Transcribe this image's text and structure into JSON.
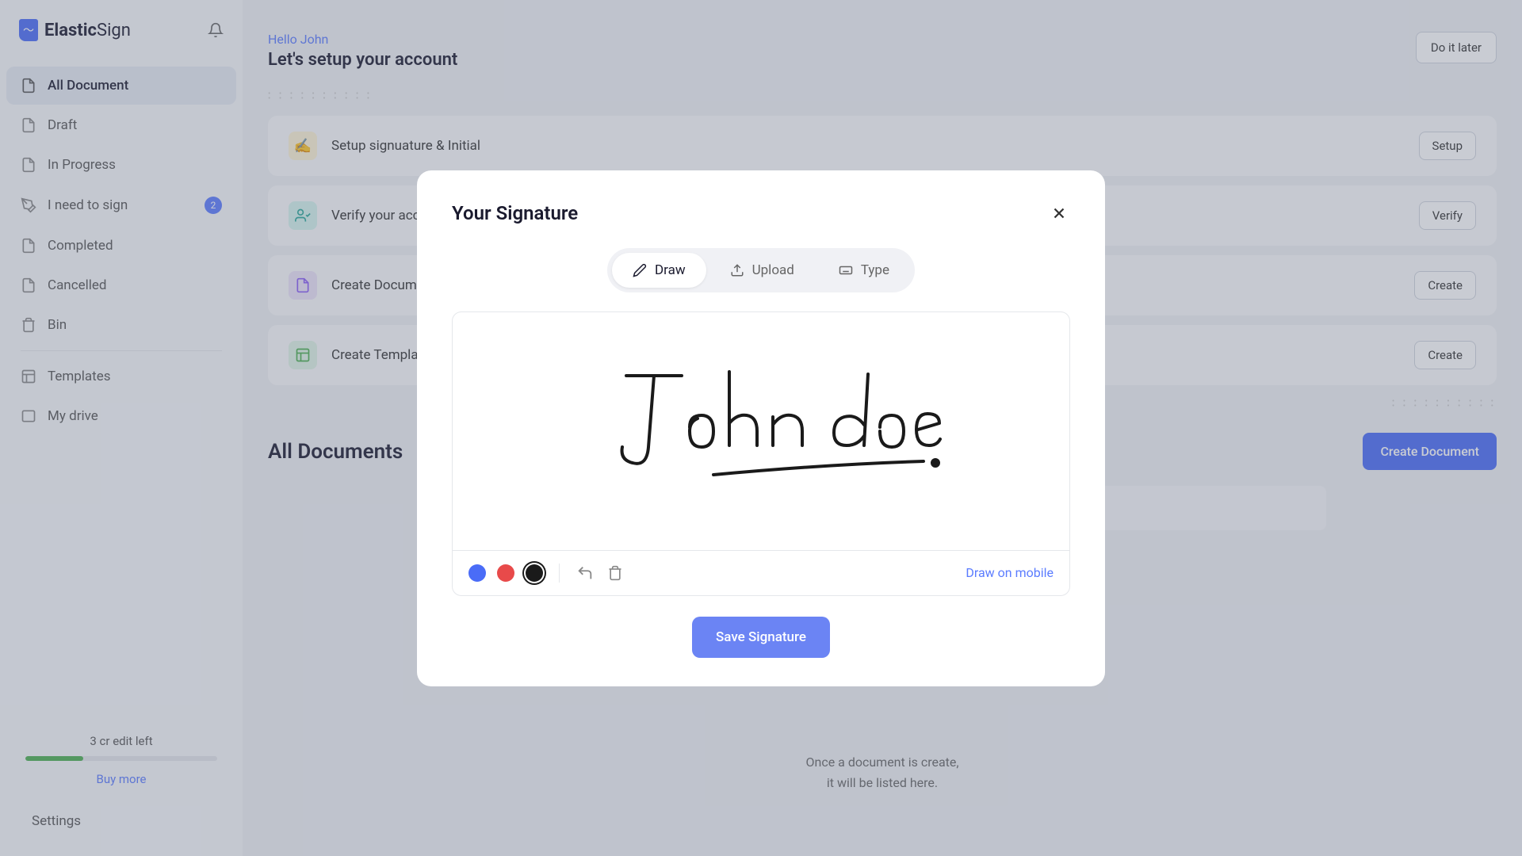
{
  "brand": {
    "bold": "Elastic",
    "light": "Sign"
  },
  "sidebar": {
    "items": [
      {
        "label": "All Document",
        "active": true
      },
      {
        "label": "Draft"
      },
      {
        "label": "In Progress"
      },
      {
        "label": "I need to sign",
        "badge": "2"
      },
      {
        "label": "Completed"
      },
      {
        "label": "Cancelled"
      },
      {
        "label": "Bin"
      }
    ],
    "section2": [
      {
        "label": "Templates"
      },
      {
        "label": "My drive"
      }
    ],
    "credit_text": "3 cr edit left",
    "buy_more": "Buy more",
    "settings": "Settings"
  },
  "header": {
    "hello": "Hello John",
    "setup_title": "Let's setup your account",
    "later": "Do it later"
  },
  "setup_steps": [
    {
      "label": "Setup signuature & Initial",
      "button": "Setup"
    },
    {
      "label": "Verify your account",
      "button": "Verify"
    },
    {
      "label": "Create Document",
      "button": "Create"
    },
    {
      "label": "Create Template",
      "button": "Create"
    }
  ],
  "docs": {
    "title": "All Documents",
    "create": "Create Document",
    "empty_line1": "Once a document is create,",
    "empty_line2": "it will be listed here."
  },
  "modal": {
    "title": "Your Signature",
    "tabs": {
      "draw": "Draw",
      "upload": "Upload",
      "type": "Type"
    },
    "draw_mobile": "Draw on mobile",
    "save": "Save Signature",
    "colors": {
      "blue": "#4a6cf7",
      "red": "#e84a4a",
      "black": "#1a1a1a"
    }
  }
}
